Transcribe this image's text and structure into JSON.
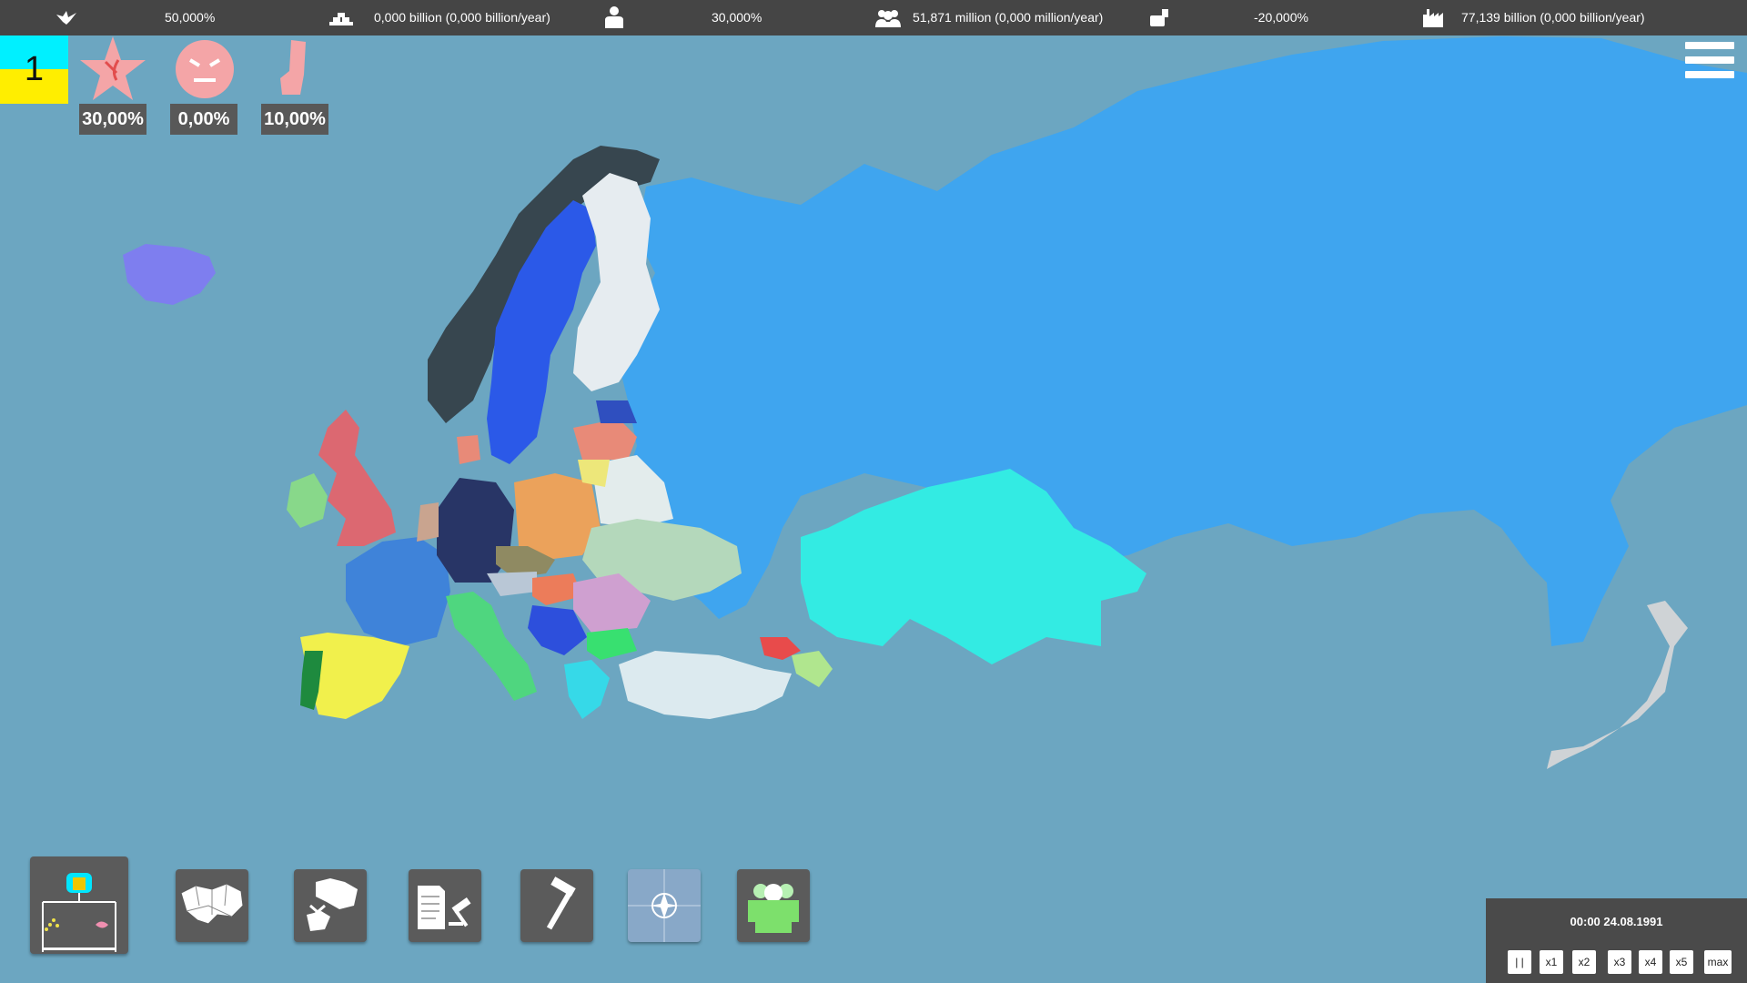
{
  "topbar": {
    "stability": {
      "icon": "dove-icon",
      "value": "50,000%"
    },
    "treasury": {
      "icon": "gold-bars-icon",
      "value": "0,000 billion (0,000 billion/year)"
    },
    "unemployment": {
      "icon": "person-icon",
      "value": "30,000%"
    },
    "population": {
      "icon": "population-icon",
      "value": "51,871 million (0,000 million/year)"
    },
    "budget": {
      "icon": "budget-icon",
      "value": "-20,000%"
    },
    "gdp": {
      "icon": "factory-icon",
      "value": "77,139 billion (0,000 billion/year)"
    }
  },
  "player_country": {
    "flag_colors": [
      "#00f0ff",
      "#ffee00"
    ],
    "number": "1"
  },
  "ideologies": [
    {
      "icon": "communism-star-icon",
      "value": "30,00%"
    },
    {
      "icon": "angry-face-icon",
      "value": "0,00%"
    },
    {
      "icon": "fist-icon",
      "value": "10,00%"
    }
  ],
  "toolbar": [
    {
      "icon": "election-icon",
      "name": "elections"
    },
    {
      "icon": "regions-map-icon",
      "name": "regions"
    },
    {
      "icon": "war-map-icon",
      "name": "war"
    },
    {
      "icon": "law-gavel-icon",
      "name": "laws"
    },
    {
      "icon": "hammer-icon",
      "name": "build"
    },
    {
      "icon": "nato-icon",
      "name": "alliance"
    },
    {
      "icon": "people-icon",
      "name": "population"
    }
  ],
  "time": {
    "clock": "00:00 24.08.1991",
    "speeds": [
      "| |",
      "x1",
      "x2",
      "x3",
      "x4",
      "x5",
      "max"
    ]
  },
  "colors": {
    "sea": "#6ca6c1",
    "russia": "#3fa5ef",
    "kazakhstan": "#33ebe3",
    "germany": "#283566",
    "france": "#3f83d9",
    "spain": "#f1f04c",
    "uk": "#dc6871",
    "poland": "#eba25b",
    "sweden": "#2b59e8",
    "norway": "#37464f",
    "finland": "#e6ecf0",
    "ukraine": "#b4d8bb",
    "turkey": "#dceaef",
    "iceland": "#7e7eef",
    "japan": "#cfd3d6"
  }
}
